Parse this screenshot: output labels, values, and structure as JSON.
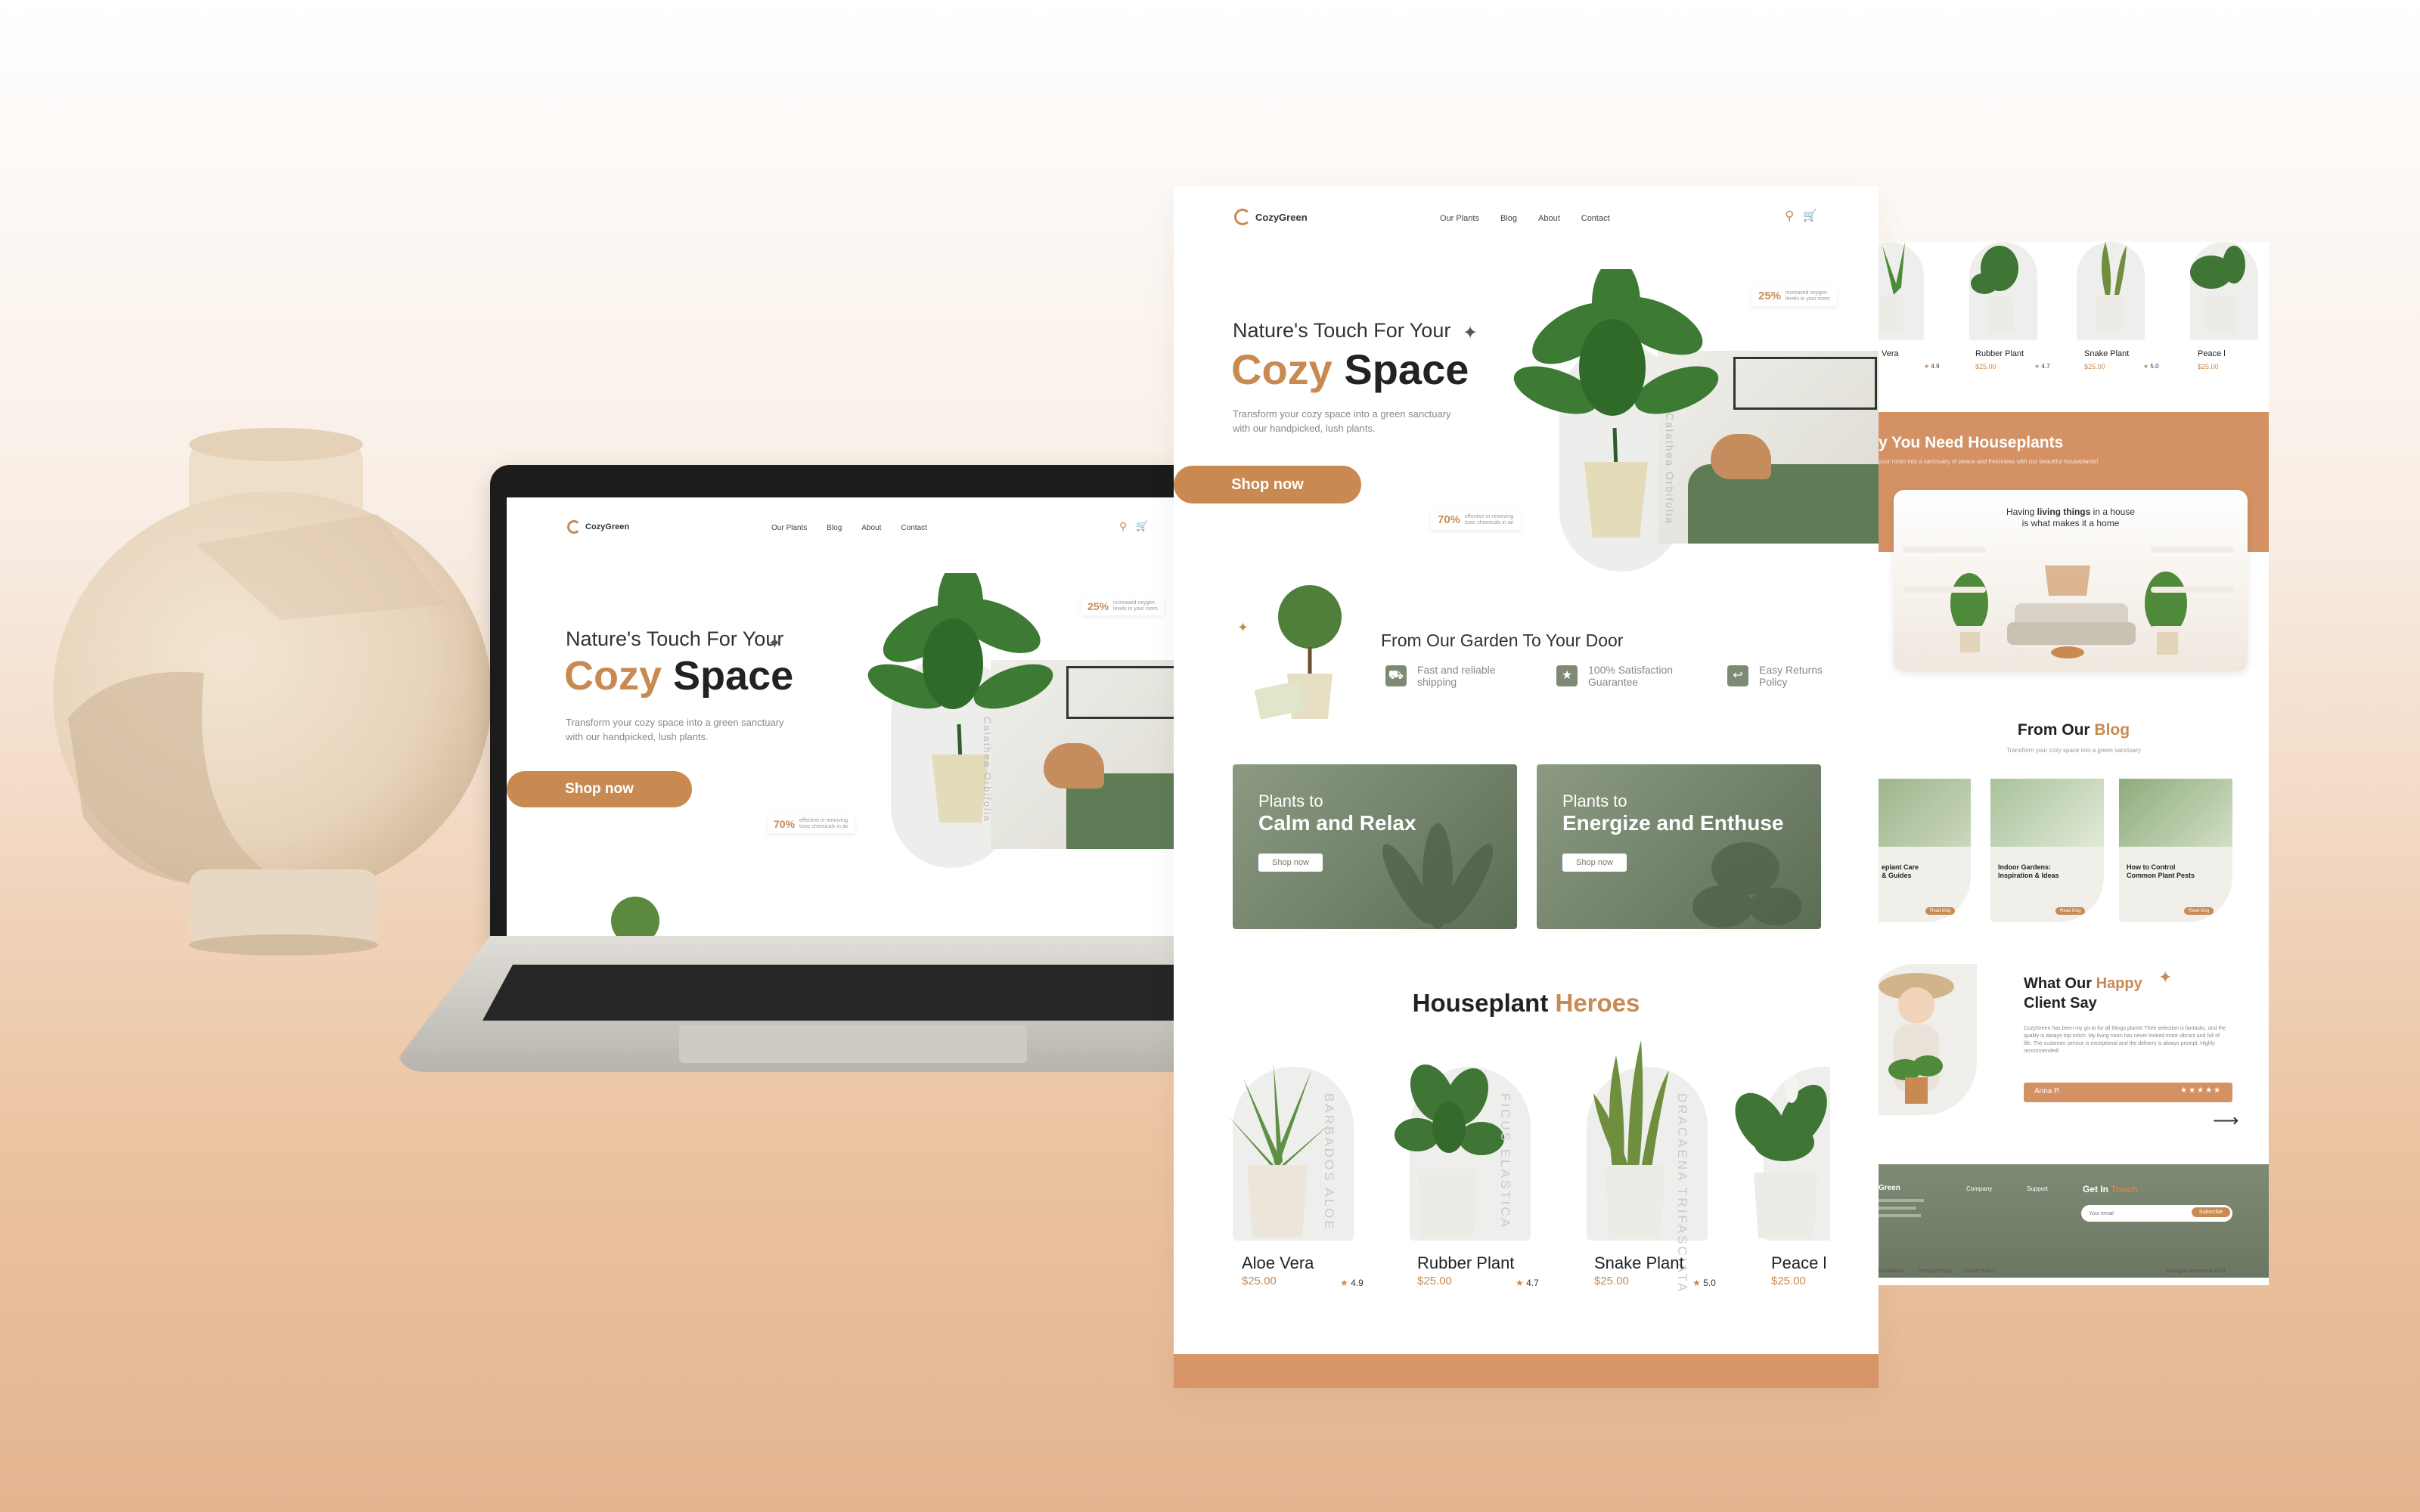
{
  "brand": {
    "name": "CozyGreen"
  },
  "nav": {
    "items": [
      "Our Plants",
      "Blog",
      "About",
      "Contact"
    ]
  },
  "hero": {
    "kicker": "Nature's Touch For Your",
    "title_accent": "Cozy",
    "title_rest": "Space",
    "subtitle_line1": "Transform your cozy space into a green sanctuary",
    "subtitle_line2": "with our handpicked, lush plants.",
    "cta": "Shop now",
    "plant_label": "Calathea Orbifolia",
    "stat1_value": "25%",
    "stat1_text_1": "increased oxygen",
    "stat1_text_2": "levels in your room",
    "stat2_value": "70%",
    "stat2_text_1": "effective in removing",
    "stat2_text_2": "toxic chemicals in air"
  },
  "garden": {
    "title": "From Our Garden To Your Door",
    "features": [
      {
        "line1": "Fast and reliable",
        "line2": "shipping",
        "icon": "truck-icon"
      },
      {
        "line1": "100% Satisfaction",
        "line2": "Guarantee",
        "icon": "badge-icon"
      },
      {
        "line1": "Easy Returns",
        "line2": "Policy",
        "icon": "return-icon"
      }
    ]
  },
  "promo": [
    {
      "small": "Plants to",
      "big": "Calm and Relax",
      "button": "Shop now"
    },
    {
      "small": "Plants to",
      "big": "Energize and Enthuse",
      "button": "Shop now"
    }
  ],
  "heroes": {
    "title": "Houseplant",
    "title_accent": "Heroes",
    "products": [
      {
        "name": "Aloe Vera",
        "price": "$25.00",
        "rating": "4.9",
        "latin": "BARBADOS ALOE"
      },
      {
        "name": "Rubber Plant",
        "price": "$25.00",
        "rating": "4.7",
        "latin": "FICUS ELASTICA"
      },
      {
        "name": "Snake Plant",
        "price": "$25.00",
        "rating": "5.0",
        "latin": "DRACAENA TRIFASCIATA"
      },
      {
        "name": "Peace l",
        "price": "$25.00",
        "rating": "",
        "latin": ""
      }
    ]
  },
  "right_page": {
    "top_products": [
      {
        "name": "Vera",
        "price": "",
        "rating": "4.9"
      },
      {
        "name": "Rubber Plant",
        "price": "$25.00",
        "rating": "4.7"
      },
      {
        "name": "Snake Plant",
        "price": "$25.00",
        "rating": "5.0"
      },
      {
        "name": "Peace l",
        "price": "$25.00",
        "rating": ""
      }
    ],
    "why_title": "y You Need Houseplants",
    "why_sub": "your room into a sanctuary of peace and freshness with our beautiful houseplants!",
    "quote_line1": "Having",
    "quote_bold": "living things",
    "quote_line1_end": "in a house",
    "quote_line2": "is what makes it a home",
    "blog_title": "From Our",
    "blog_title_accent": "Blog",
    "blog_sub": "Transform your cozy space into a green sanctuary",
    "blog_posts": [
      {
        "title_1": "eplant Care",
        "title_2": "& Guides",
        "button": "Read blog"
      },
      {
        "title_1": "Indoor Gardens:",
        "title_2": "Inspiration & Ideas",
        "button": "Read blog"
      },
      {
        "title_1": "How to Control",
        "title_2": "Common Plant Pests",
        "button": "Read blog"
      }
    ],
    "testimonial_title_1": "What Our",
    "testimonial_accent": "Happy",
    "testimonial_title_2": "Client Say",
    "testimonial_text": "CozyGreen has been my go-to for all things plants! Their selection is fantastic, and the quality is always top-notch. My living room has never looked more vibrant and full of life. The customer service is exceptional and the delivery is always prompt. Highly recommended!",
    "testimonial_name": "Anna P.",
    "testimonial_stars": "★★★★★",
    "footer_brand": "Green",
    "footer_col1": "Company",
    "footer_col2": "Support",
    "footer_touch": "Get In",
    "footer_touch_accent": "Touch",
    "footer_email_placeholder": "Your email",
    "footer_subscribe": "Subscribe",
    "footer_links": [
      "Conditions",
      "Privacy Policy",
      "Cookie Policy"
    ],
    "footer_copy": "All Rights Reserved 2024"
  },
  "colors": {
    "accent": "#c98a52",
    "sage": "#7e8a74",
    "bar": "#d9956a"
  }
}
